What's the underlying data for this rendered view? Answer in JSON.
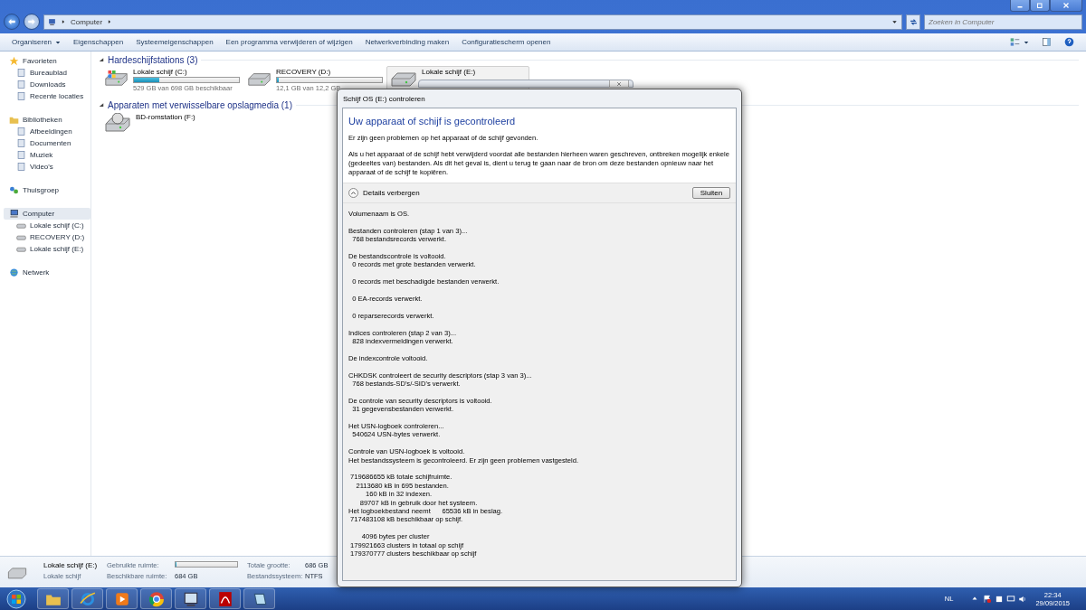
{
  "address": {
    "crumb": "Computer",
    "search_placeholder": "Zoeken in Computer"
  },
  "toolbar": {
    "items": [
      {
        "label": "Organiseren",
        "menu": true
      },
      {
        "label": "Eigenschappen",
        "menu": false
      },
      {
        "label": "Systeemeigenschappen",
        "menu": false
      },
      {
        "label": "Een programma verwijderen of wijzigen",
        "menu": false
      },
      {
        "label": "Netwerkverbinding maken",
        "menu": false
      },
      {
        "label": "Configuratiescherm openen",
        "menu": false
      }
    ]
  },
  "sidebar": {
    "groups": [
      {
        "label": "Favorieten",
        "selected": false,
        "children": [
          {
            "label": "Bureaublad"
          },
          {
            "label": "Downloads"
          },
          {
            "label": "Recente locaties"
          }
        ]
      },
      {
        "label": "Bibliotheken",
        "selected": false,
        "children": [
          {
            "label": "Afbeeldingen"
          },
          {
            "label": "Documenten"
          },
          {
            "label": "Muziek"
          },
          {
            "label": "Video's"
          }
        ]
      },
      {
        "label": "Thuisgroep",
        "selected": false
      },
      {
        "label": "Computer",
        "selected": true,
        "children": [
          {
            "label": "Lokale schijf (C:)"
          },
          {
            "label": "RECOVERY (D:)"
          },
          {
            "label": "Lokale schijf (E:)"
          }
        ]
      },
      {
        "label": "Netwerk",
        "selected": false
      }
    ]
  },
  "sections": [
    {
      "title": "Hardeschijfstations (3)",
      "drives": [
        {
          "name": "Lokale schijf (C:)",
          "kind": "system",
          "selected": false,
          "level": 0.24,
          "free": "529 GB van 698 GB beschikbaar"
        },
        {
          "name": "RECOVERY (D:)",
          "kind": "disk",
          "selected": false,
          "level": 0.02,
          "free": "12,1 GB van 12,2 GB"
        },
        {
          "name": "Lokale schijf (E:)",
          "kind": "disk",
          "selected": true
        }
      ]
    },
    {
      "title": "Apparaten met verwisselbare opslagmedia (1)",
      "drives": [
        {
          "name": "BD-romstation (F:)",
          "kind": "optical",
          "selected": false
        }
      ]
    }
  ],
  "details_pane": {
    "name": "Lokale schijf (E:)",
    "type": "Lokale schijf",
    "used_label": "Gebruikte ruimte:",
    "used_bar": {
      "level": 0.01
    },
    "free_label": "Beschikbare ruimte:",
    "free_value": "684 GB",
    "total_label": "Totale grootte:",
    "total_value": "686 GB",
    "fs_label": "Bestandssysteem:",
    "fs_value": "NTFS"
  },
  "dialog": {
    "title": "Schijf OS (E:) controleren",
    "heading": "Uw apparaat of schijf is gecontroleerd",
    "messages": [
      "Er zijn geen problemen op het apparaat of de schijf gevonden.",
      "Als u het apparaat of de schijf hebt verwijderd voordat alle bestanden hierheen waren geschreven, ontbreken mogelijk enkele (gedeeltes van) bestanden. Als dit het geval is, dient u terug te gaan naar de bron om deze bestanden opnieuw naar het apparaat of de schijf te kopiëren."
    ],
    "details_label": "Details verbergen",
    "expanded": true,
    "close_button": "Sluiten",
    "log": [
      [
        "Volumenaam is OS."
      ],
      [
        "Bestanden controleren (stap 1 van 3)...",
        "  768 bestandsrecords verwerkt."
      ],
      [
        "De bestandscontrole is voltooid.",
        "  0 records met grote bestanden verwerkt."
      ],
      [
        "  0 records met beschadigde bestanden verwerkt."
      ],
      [
        "  0 EA-records verwerkt."
      ],
      [
        "  0 reparserecords verwerkt."
      ],
      [
        "Indices controleren (stap 2 van 3)...",
        "  828 indexvermeldingen verwerkt."
      ],
      [
        "De indexcontrole voltooid."
      ],
      [
        "CHKDSK controleert de security descriptors (stap 3 van 3)...",
        "  768 bestands-SD's/-SID's verwerkt."
      ],
      [
        "De controle van security descriptors is voltooid.",
        "  31 gegevensbestanden verwerkt."
      ],
      [
        "Het USN-logboek controleren...",
        "  540624 USN-bytes verwerkt."
      ],
      [
        "Controle van USN-logboek is voltooid.",
        "Het bestandssysteem is gecontroleerd. Er zijn geen problemen vastgesteld."
      ],
      [
        " 719686655 kB totale schijfruimte.",
        "    2113680 kB in 695 bestanden.",
        "         160 kB in 32 indexen.",
        "      89707 kB in gebruik door het systeem.",
        "Het logboekbestand neemt      65536 kB in beslag.",
        " 717483108 kB beschikbaar op schijf."
      ],
      [
        "       4096 bytes per cluster",
        " 179921663 clusters in totaal op schijf",
        " 179370777 clusters beschikbaar op schijf"
      ]
    ]
  },
  "tray": {
    "language": "NL",
    "time": "22:34",
    "date": "29/09/2015"
  }
}
